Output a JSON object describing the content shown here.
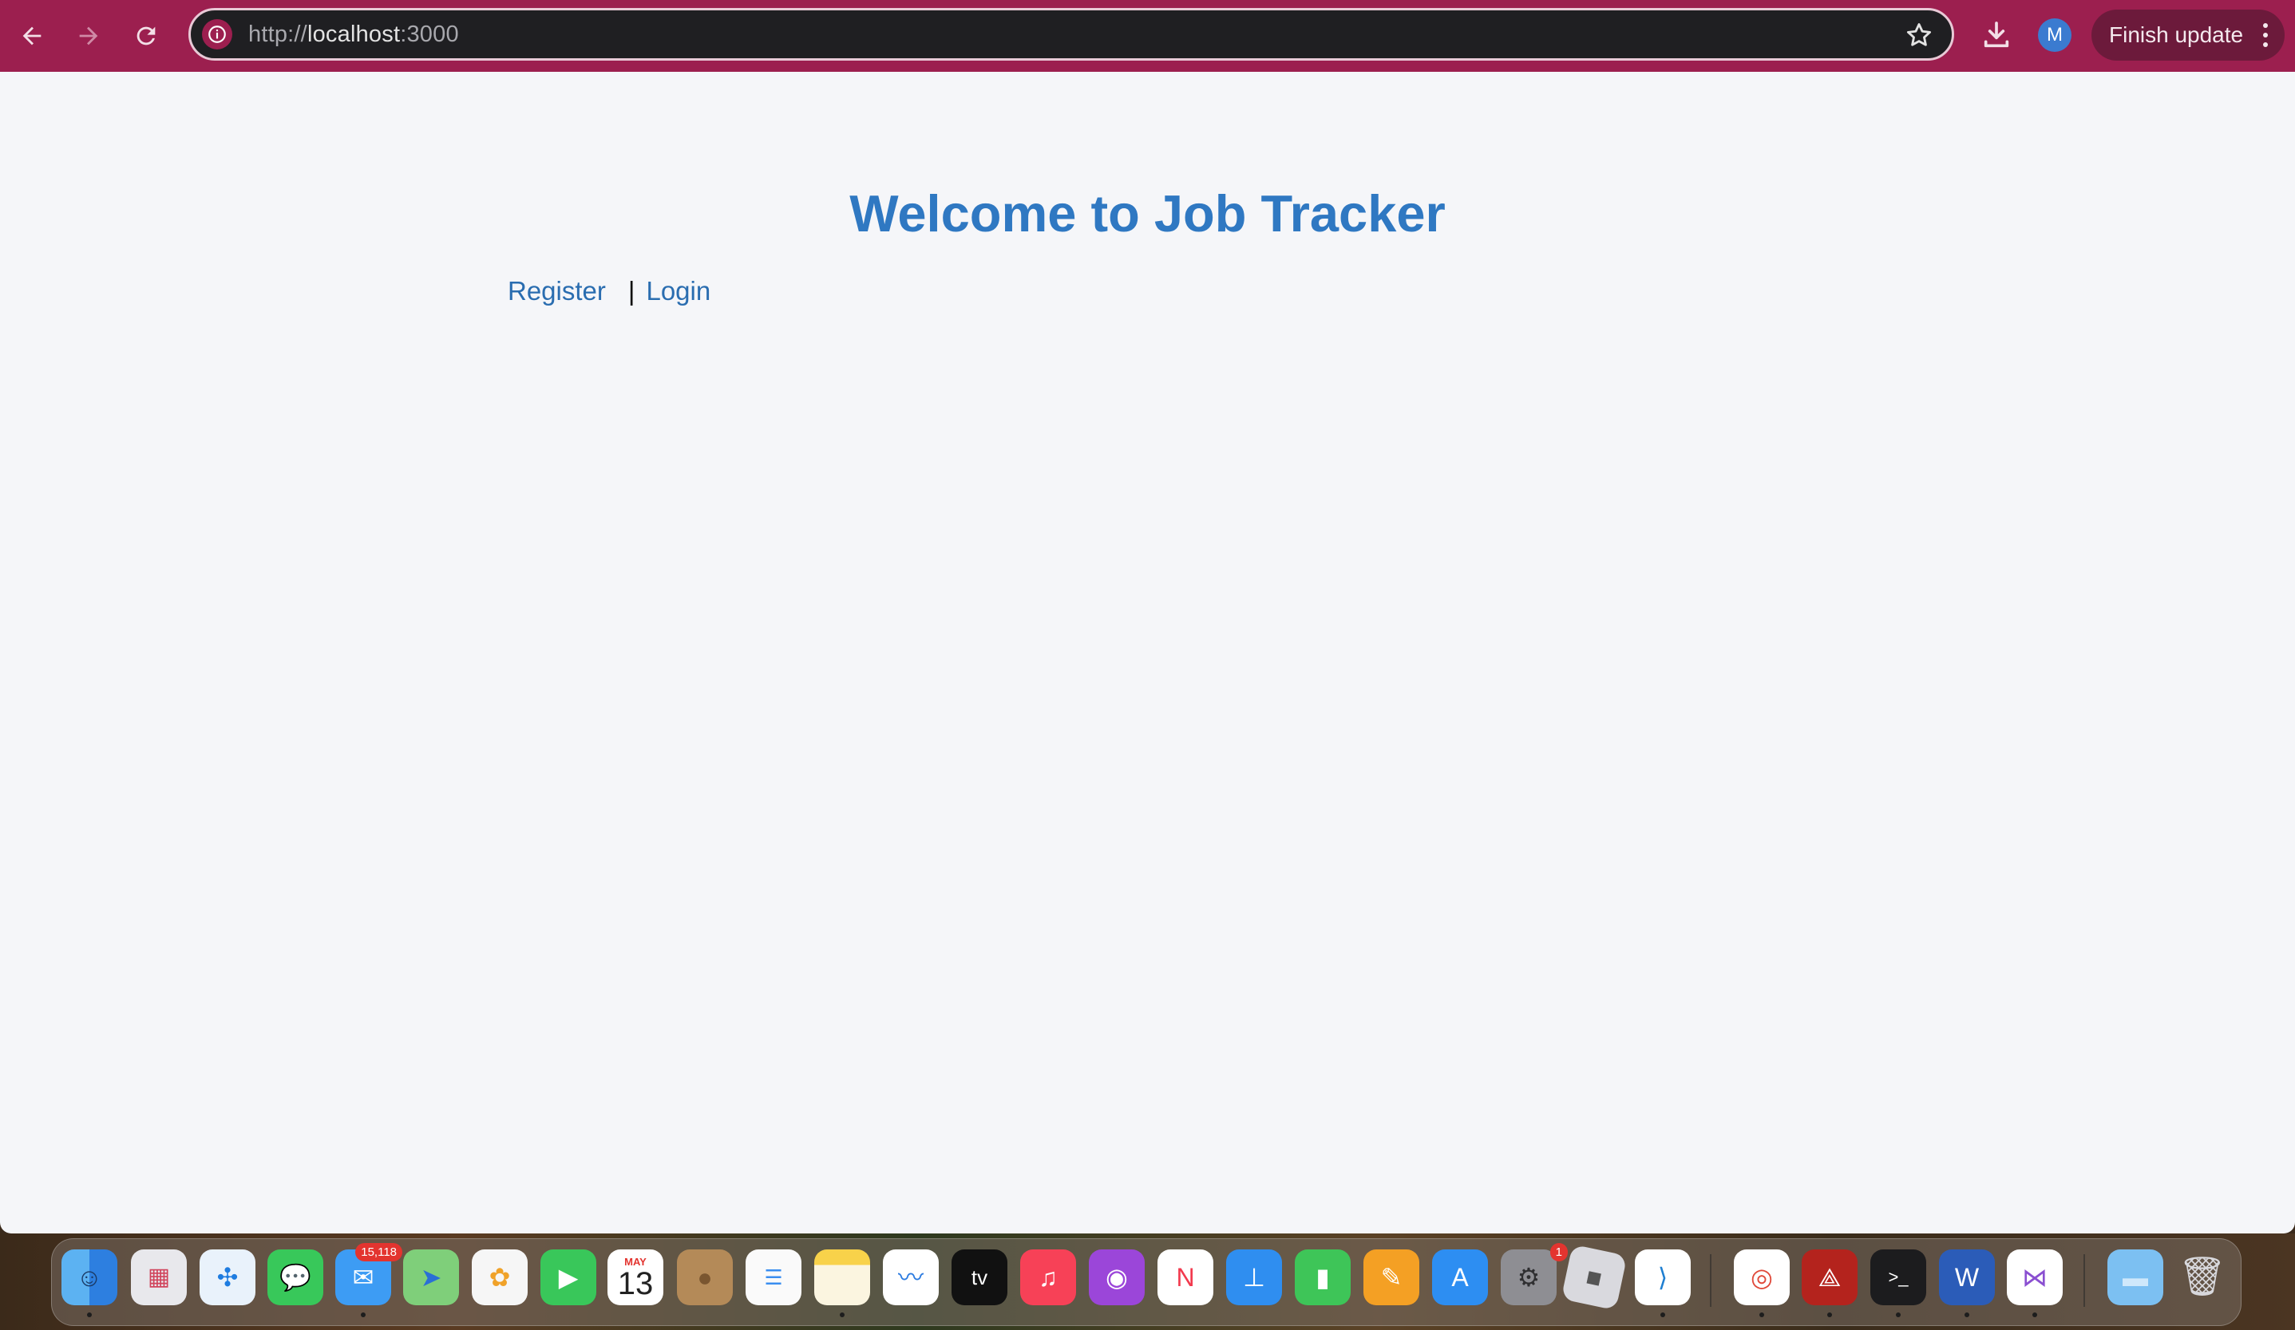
{
  "browser": {
    "url_scheme": "http://",
    "url_host": "localhost",
    "url_port": ":3000",
    "profile_initial": "M",
    "finish_update_label": "Finish update"
  },
  "page": {
    "title": "Welcome to Job Tracker",
    "register_label": "Register",
    "separator": "|",
    "login_label": "Login"
  },
  "dock": {
    "mail_badge": "15,118",
    "calendar_month": "MAY",
    "calendar_day": "13",
    "settings_badge": "1",
    "apps": [
      "finder",
      "launchpad",
      "safari",
      "messages",
      "mail",
      "maps",
      "photos",
      "facetime",
      "calendar",
      "contacts",
      "reminders",
      "notes",
      "freeform",
      "apple-tv",
      "music",
      "podcasts",
      "news",
      "keynote",
      "numbers",
      "pages",
      "app-store",
      "system-settings",
      "roblox",
      "vscode",
      "chrome",
      "acrobat",
      "terminal",
      "word",
      "visual-studio",
      "downloads-folder",
      "trash"
    ]
  },
  "colors": {
    "toolbar": "#9c1f4f",
    "title": "#2f78c2",
    "link": "#2a6db0",
    "page_bg": "#f5f6f9"
  }
}
